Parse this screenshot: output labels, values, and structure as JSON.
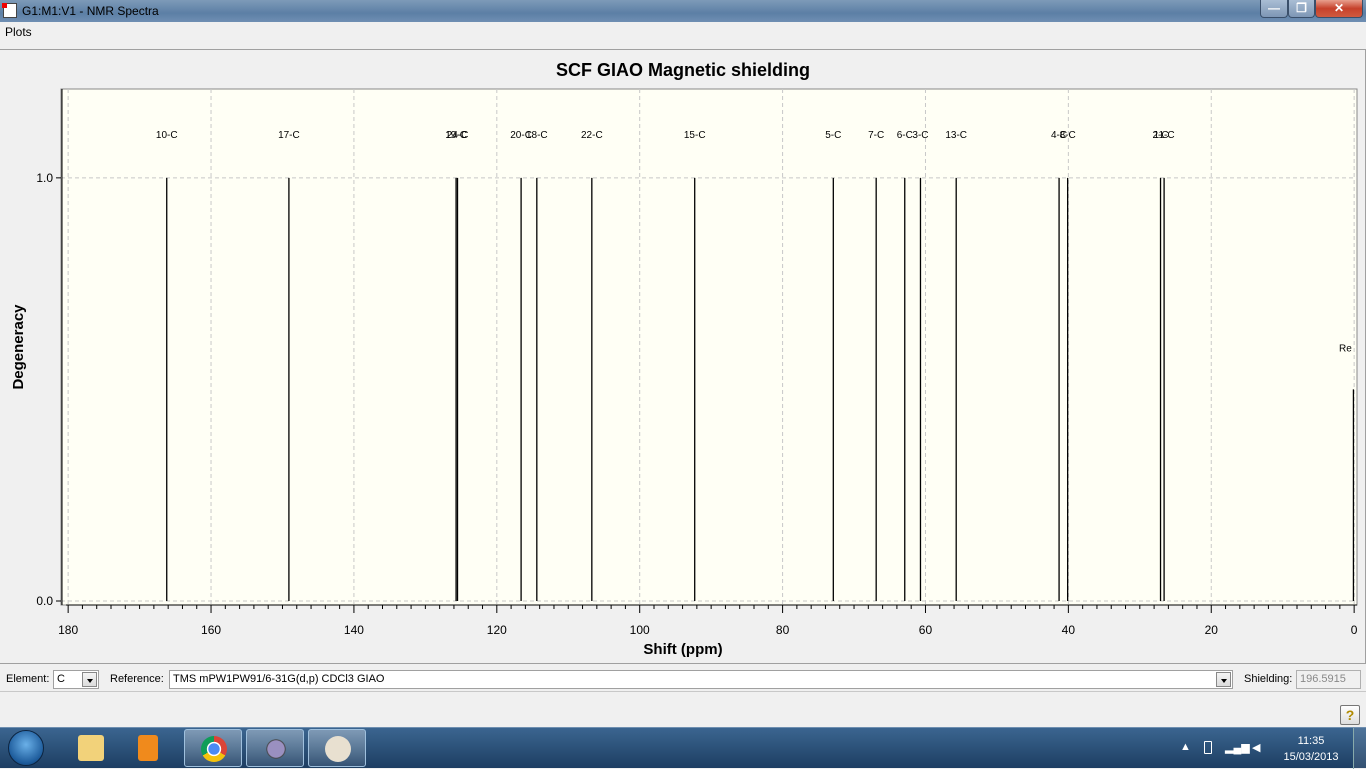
{
  "window": {
    "title": "G1:M1:V1 - NMR Spectra",
    "minimize": "—",
    "maximize": "❐",
    "close": "✕"
  },
  "menu": {
    "items": [
      "Plots"
    ]
  },
  "chart_data": {
    "type": "bar",
    "title": "SCF GIAO Magnetic shielding",
    "xlabel": "Shift (ppm)",
    "ylabel": "Degeneracy",
    "xlim": [
      181,
      -0.4
    ],
    "ylim": [
      0,
      1.21
    ],
    "xticks": [
      180,
      160,
      140,
      120,
      100,
      80,
      60,
      40,
      20,
      0
    ],
    "xminor_step": 2,
    "yticks": [
      {
        "v": 0,
        "label": "0.0"
      },
      {
        "v": 1,
        "label": "1.0"
      }
    ],
    "grid": true,
    "peaks": [
      {
        "label": "10-C",
        "shift": 166.2,
        "degeneracy": 1
      },
      {
        "label": "17-C",
        "shift": 149.1,
        "degeneracy": 1
      },
      {
        "label": "19-C",
        "shift": 125.7,
        "degeneracy": 1
      },
      {
        "label": "24-C",
        "shift": 125.5,
        "degeneracy": 1
      },
      {
        "label": "20-C",
        "shift": 116.6,
        "degeneracy": 1
      },
      {
        "label": "18-C",
        "shift": 114.4,
        "degeneracy": 1
      },
      {
        "label": "22-C",
        "shift": 106.7,
        "degeneracy": 1
      },
      {
        "label": "15-C",
        "shift": 92.3,
        "degeneracy": 1
      },
      {
        "label": "5-C",
        "shift": 72.9,
        "degeneracy": 1
      },
      {
        "label": "7-C",
        "shift": 66.9,
        "degeneracy": 1
      },
      {
        "label": "6-C",
        "shift": 62.9,
        "degeneracy": 1
      },
      {
        "label": "3-C",
        "shift": 60.7,
        "degeneracy": 1
      },
      {
        "label": "13-C",
        "shift": 55.7,
        "degeneracy": 1
      },
      {
        "label": "4-C",
        "shift": 41.3,
        "degeneracy": 1
      },
      {
        "label": "8-C",
        "shift": 40.1,
        "degeneracy": 1
      },
      {
        "label": "2-C",
        "shift": 27.1,
        "degeneracy": 1
      },
      {
        "label": "11-C",
        "shift": 26.6,
        "degeneracy": 1
      },
      {
        "label": "Re",
        "shift": 0.1,
        "degeneracy": 0.5
      }
    ]
  },
  "controls": {
    "element_label": "Element:",
    "element_value": "C",
    "reference_label": "Reference:",
    "reference_value": "TMS mPW1PW91/6-31G(d,p) CDCl3 GIAO",
    "shielding_label": "Shielding:",
    "shielding_value": "196.5915",
    "help": "?"
  },
  "taskbar": {
    "time": "11:35",
    "date": "15/03/2013"
  },
  "colors": {
    "plot_bg": "#fffff5",
    "grid": "#c8c8c8",
    "peak": "#000000"
  }
}
